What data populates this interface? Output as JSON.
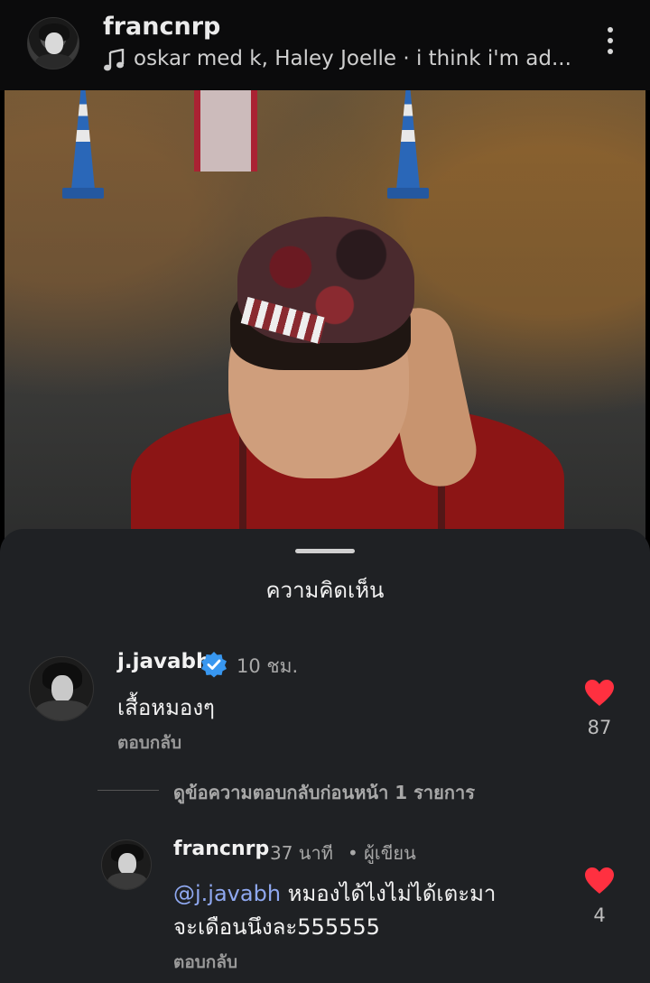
{
  "post": {
    "username": "francnrp",
    "music": "oskar med k, Haley Joelle · i think i'm ad..."
  },
  "sheet": {
    "title": "ความคิดเห็น"
  },
  "comments": [
    {
      "username": "j.javabh",
      "verified": true,
      "time": "10 ชม.",
      "text": "เสื้อหมองๆ",
      "reply_label": "ตอบกลับ",
      "likes": "87"
    }
  ],
  "view_replies": "ดูข้อความตอบกลับก่อนหน้า 1 รายการ",
  "reply": {
    "username": "francnrp",
    "time": "37 นาที",
    "author_tag": "• ผู้เขียน",
    "mention": "@j.javabh",
    "text_line1": " หมองได้ไงไม่ได้เตะมา",
    "text_line2": "จะเดือนนึงละ555555",
    "reply_label": "ตอบกลับ",
    "likes": "4"
  },
  "colors": {
    "sheet_bg": "#1f2124",
    "heart": "#ff3040",
    "verified": "#3897f0",
    "mention": "#8fa8f0"
  },
  "icons": [
    "music-note-icon",
    "more-options-icon",
    "verified-badge-icon",
    "heart-icon"
  ]
}
